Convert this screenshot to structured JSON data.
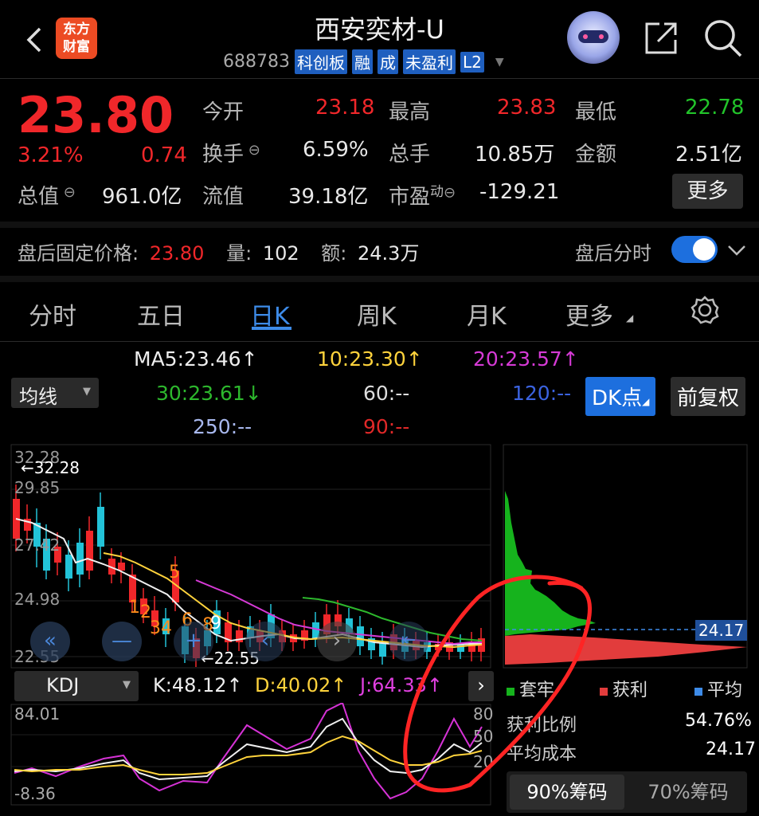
{
  "header": {
    "title": "西安奕材-U",
    "code": "688783",
    "tags": [
      "科创板",
      "融",
      "成",
      "未盈利",
      "L2"
    ],
    "logo": [
      "东方",
      "财富"
    ]
  },
  "quote": {
    "price": "23.80",
    "change_pct": "3.21%",
    "change": "0.74",
    "open_label": "今开",
    "open": "23.18",
    "high_label": "最高",
    "high": "23.83",
    "low_label": "最低",
    "low": "22.78",
    "turnover_label": "换手",
    "turnover": "6.59%",
    "volume_label": "总手",
    "volume": "10.85万",
    "amount_label": "金额",
    "amount": "2.51亿",
    "mktcap_label": "总值",
    "mktcap": "961.0亿",
    "float_label": "流值",
    "float": "39.18亿",
    "pe_label": "市盈",
    "pe_sup": "动",
    "pe": "-129.21",
    "more": "更多"
  },
  "after_hours": {
    "price_label": "盘后固定价格:",
    "price": "23.80",
    "vol_label": "量:",
    "vol": "102",
    "amt_label": "额:",
    "amt": "24.3万",
    "toggle_label": "盘后分时",
    "toggle_on": true
  },
  "tabs": [
    "分时",
    "五日",
    "日K",
    "周K",
    "月K",
    "更多"
  ],
  "active_tab": "日K",
  "ma": {
    "selector": "均线",
    "ma5": "MA5:23.46↑",
    "ma10": "10:23.30↑",
    "ma20": "20:23.57↑",
    "ma30": "30:23.61↓",
    "ma60": "60:--",
    "ma120": "120:--",
    "ma250": "250:--",
    "ma90": "90:--",
    "dk_button": "DK点",
    "adjust_button": "前复权"
  },
  "kchart": {
    "y_labels": [
      "32.28",
      "29.85",
      "27.42",
      "24.98",
      "22.55"
    ],
    "max_marker": "←32.28",
    "min_marker": "←22.55",
    "buy_sell_marks": [
      "5",
      "1",
      "2",
      "3",
      "4",
      "6",
      "8",
      "9"
    ],
    "chip_avg": "24.17"
  },
  "kdj": {
    "selector": "KDJ",
    "k": "K:48.12↑",
    "d": "D:40.02↑",
    "j": "J:64.33↑",
    "y_top": "84.01",
    "y_bottom": "-8.36",
    "right_levels": [
      "80",
      "50",
      "20"
    ]
  },
  "chips": {
    "legend": [
      "套牢",
      "获利",
      "平均"
    ],
    "profit_ratio_label": "获利比例",
    "profit_ratio": "54.76%",
    "avg_cost_label": "平均成本",
    "avg_cost": "24.17",
    "tab_90": "90%筹码",
    "tab_70": "70%筹码"
  },
  "colors": {
    "up": "#f0272a",
    "down": "#22c3d8",
    "accent": "#1d6fde",
    "annotation": "#ff2a2a"
  }
}
